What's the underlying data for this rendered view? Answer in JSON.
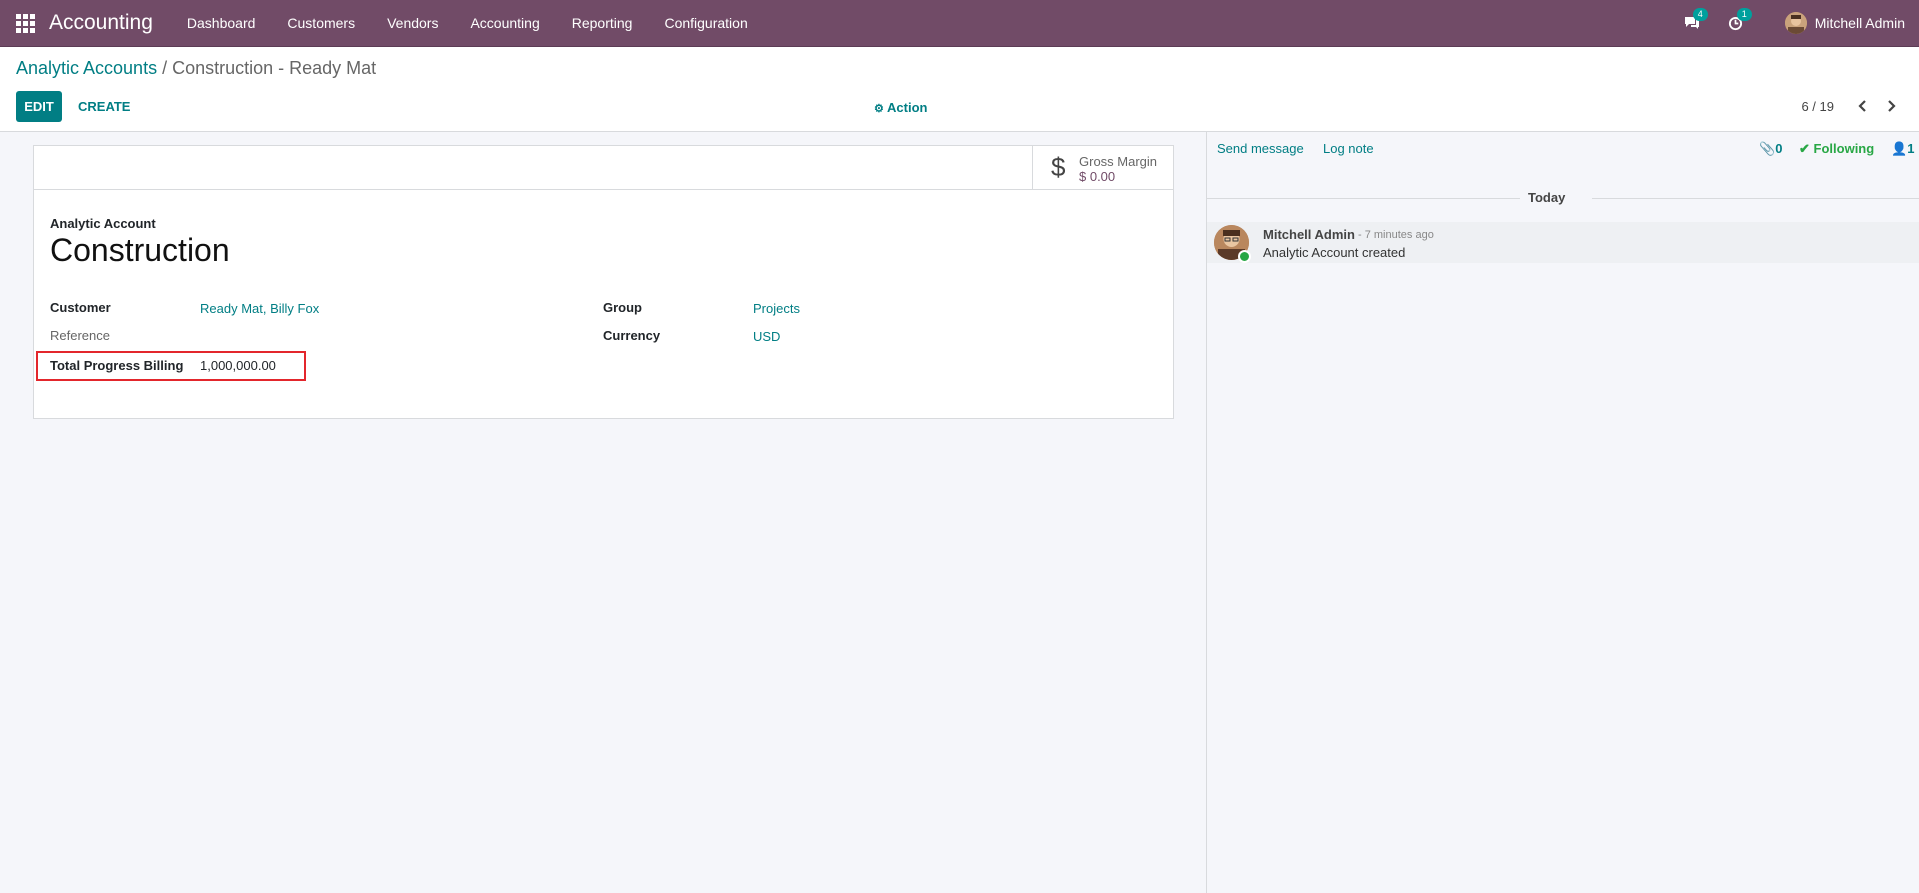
{
  "navbar": {
    "app_title": "Accounting",
    "menu": [
      "Dashboard",
      "Customers",
      "Vendors",
      "Accounting",
      "Reporting",
      "Configuration"
    ],
    "messages_count": "4",
    "activities_count": "1",
    "user_name": "Mitchell Admin",
    "bg_color": "#714b67"
  },
  "breadcrumb": {
    "parent": "Analytic Accounts",
    "separator": " / ",
    "current": "Construction - Ready Mat"
  },
  "toolbar": {
    "edit_label": "EDIT",
    "create_label": "CREATE",
    "action_label": "Action",
    "pager": "6 / 19"
  },
  "stat_button": {
    "label": "Gross Margin",
    "value": "$ 0.00"
  },
  "form": {
    "title_label": "Analytic Account",
    "title": "Construction",
    "fields": {
      "customer_label": "Customer",
      "customer_value": "Ready Mat, Billy Fox",
      "reference_label": "Reference",
      "billing_label": "Total Progress Billing",
      "billing_value": "1,000,000.00",
      "group_label": "Group",
      "group_value": "Projects",
      "currency_label": "Currency",
      "currency_value": "USD"
    }
  },
  "chatter": {
    "send_message": "Send message",
    "log_note": "Log note",
    "attachments": "0",
    "following": "Following",
    "followers": "1",
    "date_separator": "Today",
    "message": {
      "author": "Mitchell Admin",
      "time": "- 7 minutes ago",
      "body": "Analytic Account created"
    }
  },
  "colors": {
    "accent": "#017e84",
    "brand": "#714b67",
    "highlight": "#e3262c",
    "following": "#28a745"
  }
}
